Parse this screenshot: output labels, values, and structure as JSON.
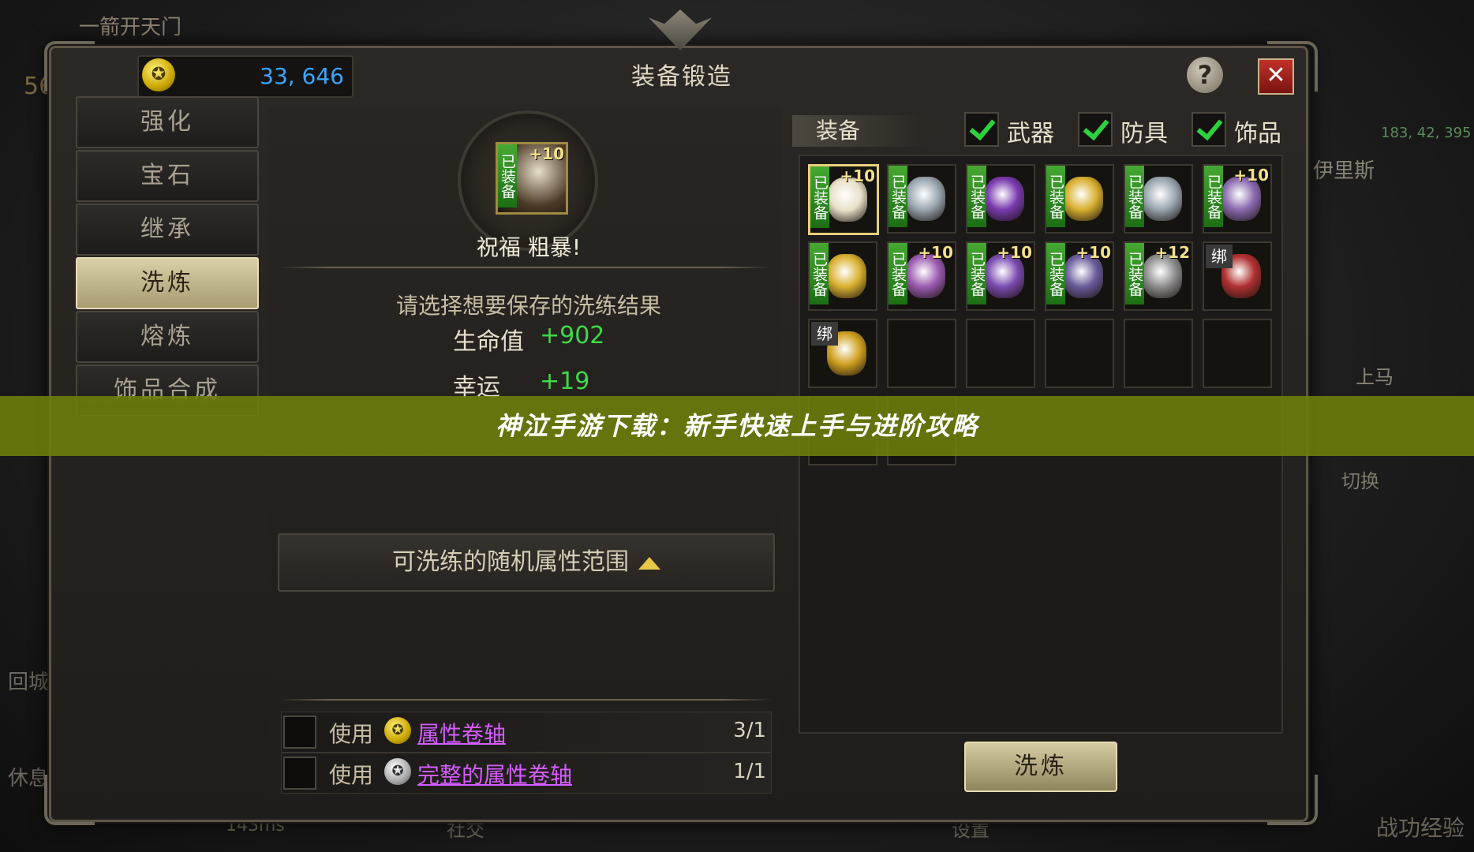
{
  "background": {
    "top_left_title": "一箭开天门",
    "level_badge": "56",
    "map_coords": "183, 42, 395",
    "target_name": "伊里斯",
    "mount_label": "上马",
    "switch_label": "切换",
    "return_city_label": "回城",
    "rest_label": "休息",
    "ping": "143ms",
    "social_label": "社交",
    "settings_label": "设置",
    "exp_label": "战功经验"
  },
  "header": {
    "gold_icon": "gold-coin-icon",
    "gold_amount": "33, 646",
    "title": "装备锻造",
    "help_label": "?",
    "close_label": "✕"
  },
  "menu": {
    "items": [
      {
        "label": "强化",
        "active": false
      },
      {
        "label": "宝石",
        "active": false
      },
      {
        "label": "继承",
        "active": false
      },
      {
        "label": "洗炼",
        "active": true
      },
      {
        "label": "熔炼",
        "active": false
      },
      {
        "label": "饰品合成",
        "active": false
      }
    ]
  },
  "refine": {
    "selected_item": {
      "equipped_tag": "已装备",
      "plus": "+10"
    },
    "blessing_text": "祝福 粗暴!",
    "prompt": "请选择想要保存的洗练结果",
    "stats": [
      {
        "label": "生命值",
        "value": "+902"
      },
      {
        "label": "幸运",
        "value": "+19"
      }
    ],
    "range_button_label": "可洗练的随机属性范围",
    "use_rows": [
      {
        "use_label": "使用",
        "icon": "gold-scroll-icon",
        "name": "属性卷轴",
        "count": "3/1"
      },
      {
        "use_label": "使用",
        "icon": "silver-scroll-icon",
        "name": "完整的属性卷轴",
        "count": "1/1"
      }
    ]
  },
  "inventory": {
    "tab_label": "装备",
    "filters": [
      {
        "label": "武器",
        "checked": true
      },
      {
        "label": "防具",
        "checked": true
      },
      {
        "label": "饰品",
        "checked": true
      }
    ],
    "equipped_tag": "已装备",
    "bind_tag": "绑",
    "slots": [
      {
        "tag": "equipped",
        "plus": "+10",
        "color": "#e8e0c8",
        "selected": true
      },
      {
        "tag": "equipped",
        "plus": "",
        "color": "#9aa6b0"
      },
      {
        "tag": "equipped",
        "plus": "",
        "color": "#7a3ab0"
      },
      {
        "tag": "equipped",
        "plus": "",
        "color": "#d9b030"
      },
      {
        "tag": "equipped",
        "plus": "",
        "color": "#9aa6b0"
      },
      {
        "tag": "equipped",
        "plus": "+10",
        "color": "#8a6ab0"
      },
      {
        "tag": "equipped",
        "plus": "",
        "color": "#d9b030"
      },
      {
        "tag": "equipped",
        "plus": "+10",
        "color": "#9a5ab0"
      },
      {
        "tag": "equipped",
        "plus": "+10",
        "color": "#7a4ab0"
      },
      {
        "tag": "equipped",
        "plus": "+10",
        "color": "#6a5a9a"
      },
      {
        "tag": "equipped",
        "plus": "+12",
        "color": "#8c8c8c"
      },
      {
        "tag": "bind",
        "plus": "",
        "color": "#b03030"
      },
      {
        "tag": "bind",
        "plus": "",
        "color": "#d0a020"
      },
      {
        "tag": "",
        "plus": "",
        "color": ""
      },
      {
        "tag": "",
        "plus": "",
        "color": ""
      },
      {
        "tag": "",
        "plus": "",
        "color": ""
      },
      {
        "tag": "",
        "plus": "",
        "color": ""
      },
      {
        "tag": "",
        "plus": "",
        "color": ""
      },
      {
        "tag": "",
        "plus": "",
        "color": ""
      },
      {
        "tag": "",
        "plus": "",
        "color": ""
      }
    ],
    "forge_button_label": "洗炼"
  },
  "banner": {
    "text": "神泣手游下载：新手快速上手与进阶攻略"
  }
}
